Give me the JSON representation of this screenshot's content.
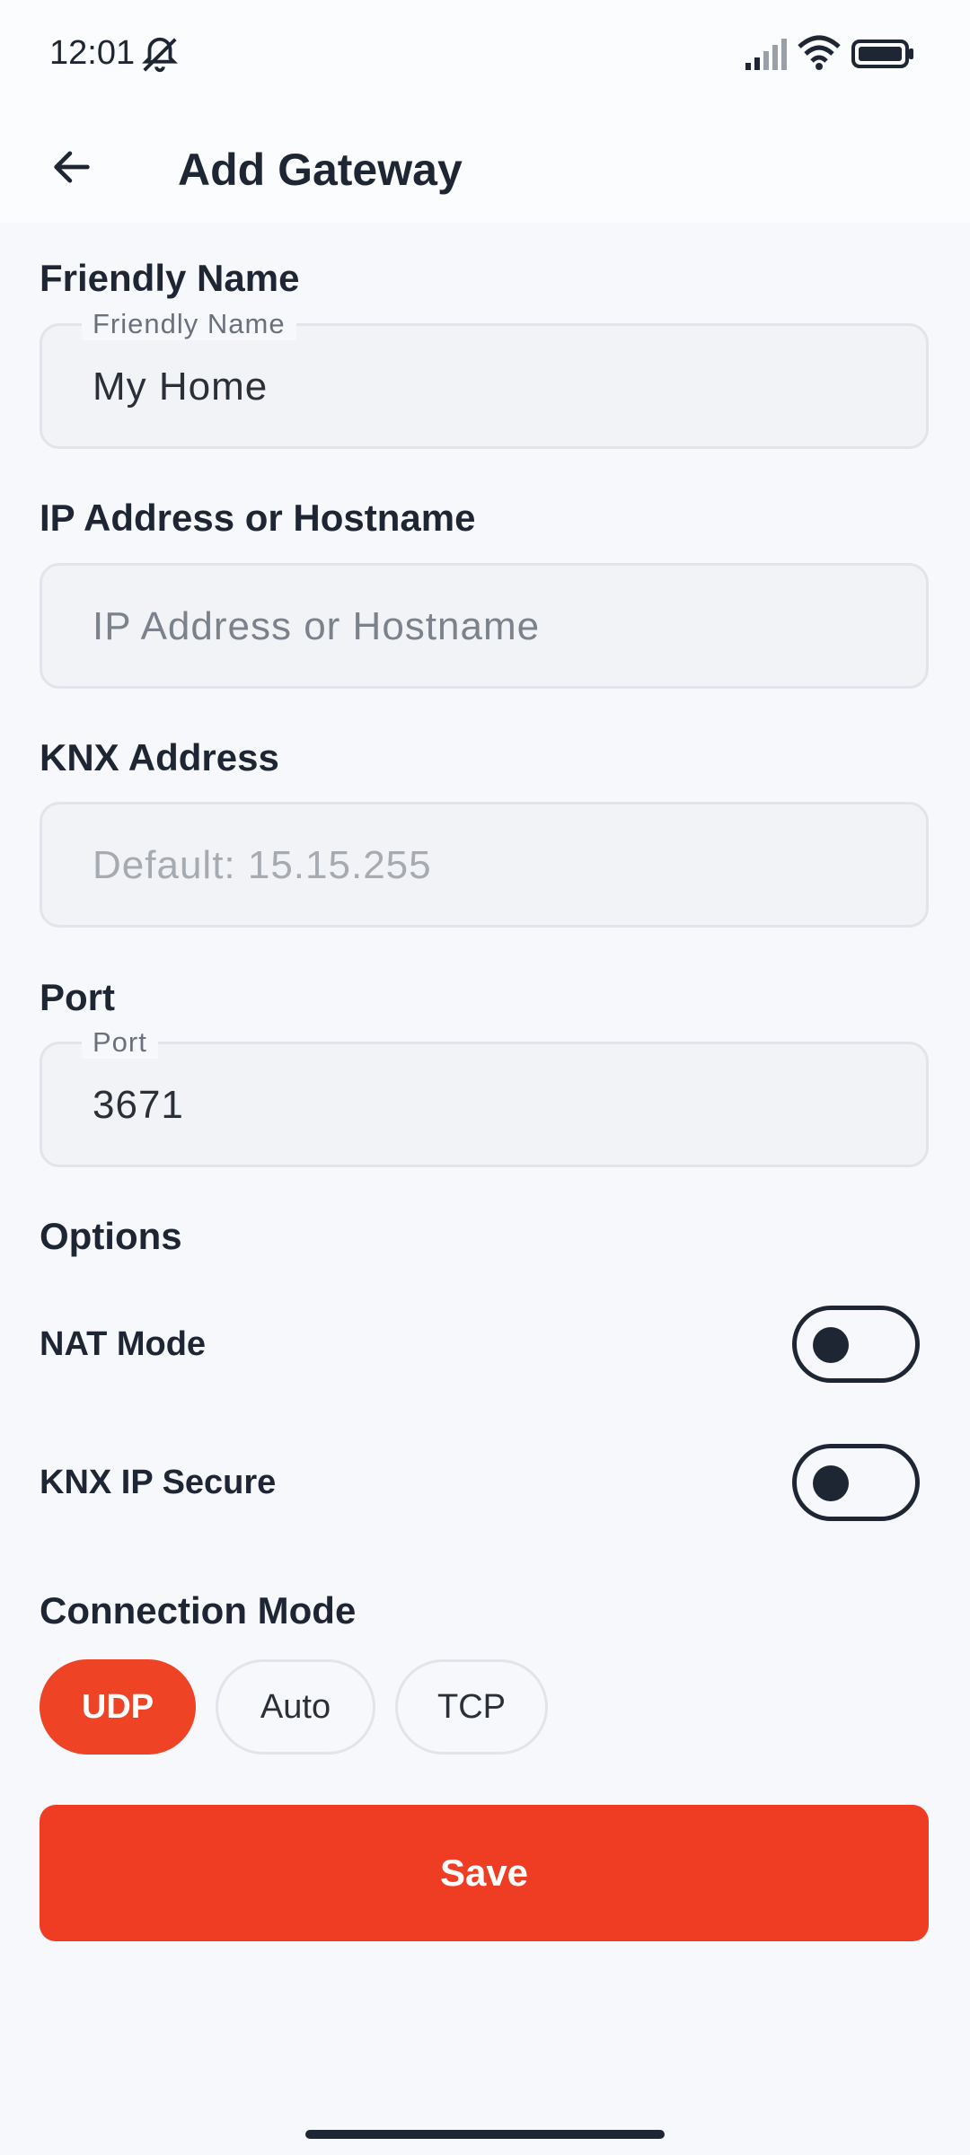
{
  "status_bar": {
    "time": "12:01"
  },
  "app_bar": {
    "title": "Add Gateway"
  },
  "form": {
    "friendly_name": {
      "section_label": "Friendly Name",
      "float_label": "Friendly Name",
      "value": "My Home"
    },
    "ip_address": {
      "section_label": "IP Address or Hostname",
      "placeholder": "IP Address or Hostname",
      "value": ""
    },
    "knx_address": {
      "section_label": "KNX Address",
      "placeholder": "Default: 15.15.255",
      "value": ""
    },
    "port": {
      "section_label": "Port",
      "float_label": "Port",
      "value": "3671"
    }
  },
  "options": {
    "title": "Options",
    "nat_mode": {
      "label": "NAT Mode",
      "enabled": false
    },
    "knx_ip_secure": {
      "label": "KNX IP Secure",
      "enabled": false
    }
  },
  "connection_mode": {
    "title": "Connection Mode",
    "chips": [
      {
        "label": "UDP",
        "selected": true
      },
      {
        "label": "Auto",
        "selected": false
      },
      {
        "label": "TCP",
        "selected": false
      }
    ]
  },
  "save_button": {
    "label": "Save"
  },
  "colors": {
    "accent": "#ee3d22",
    "text": "#1f2633",
    "background": "#f6f8fc"
  }
}
